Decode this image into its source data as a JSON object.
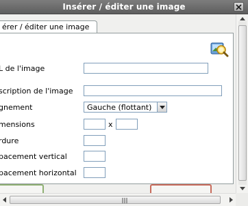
{
  "window": {
    "title": "Insérer / éditer une image"
  },
  "tab": {
    "label": "érer / éditer une image"
  },
  "form": {
    "url_label": "L de l'image",
    "url_value": "",
    "description_label": "scription de l'image",
    "description_value": "",
    "alignment_label": "gnement",
    "alignment_value": "Gauche (flottant)",
    "dimensions_label": "mensions",
    "width_value": "",
    "dimensions_separator": "x",
    "height_value": "",
    "border_label": "rdure",
    "border_value": "",
    "vspace_label": "pacement vertical",
    "vspace_value": "",
    "hspace_label": "pacement horizontal",
    "hspace_value": ""
  },
  "icons": {
    "close": "close-icon",
    "browse": "browse-image-icon",
    "dropdown": "chevron-down-icon"
  },
  "colors": {
    "titlebar": "#6b6b6b",
    "field_border": "#7f9db9",
    "insert_button_border": "#8fb073",
    "cancel_button_border": "#c86b5b"
  }
}
